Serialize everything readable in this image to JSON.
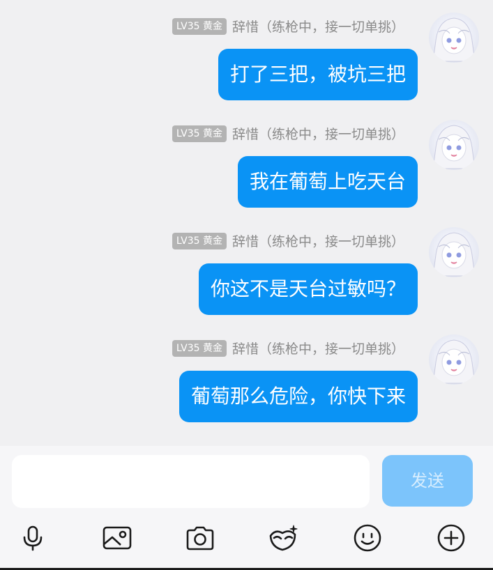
{
  "messages": [
    {
      "badge": "LV35 黄金",
      "name": "辞惜（练枪中，接一切单挑）",
      "text": "打了三把，被坑三把"
    },
    {
      "badge": "LV35 黄金",
      "name": "辞惜（练枪中，接一切单挑）",
      "text": "我在葡萄上吃天台"
    },
    {
      "badge": "LV35 黄金",
      "name": "辞惜（练枪中，接一切单挑）",
      "text": "你这不是天台过敏吗？"
    },
    {
      "badge": "LV35 黄金",
      "name": "辞惜（练枪中，接一切单挑）",
      "text": "葡萄那么危险，你快下来"
    }
  ],
  "composer": {
    "value": "",
    "send_label": "发送"
  },
  "toolbar": {
    "icons": [
      "microphone-icon",
      "image-icon",
      "camera-icon",
      "mask-sticker-icon",
      "emoji-icon",
      "add-icon"
    ]
  },
  "colors": {
    "bubble": "#0a93f5",
    "send_disabled": "#7cc4fb",
    "badge": "#b3b3b3",
    "background": "#f0f0f2"
  }
}
